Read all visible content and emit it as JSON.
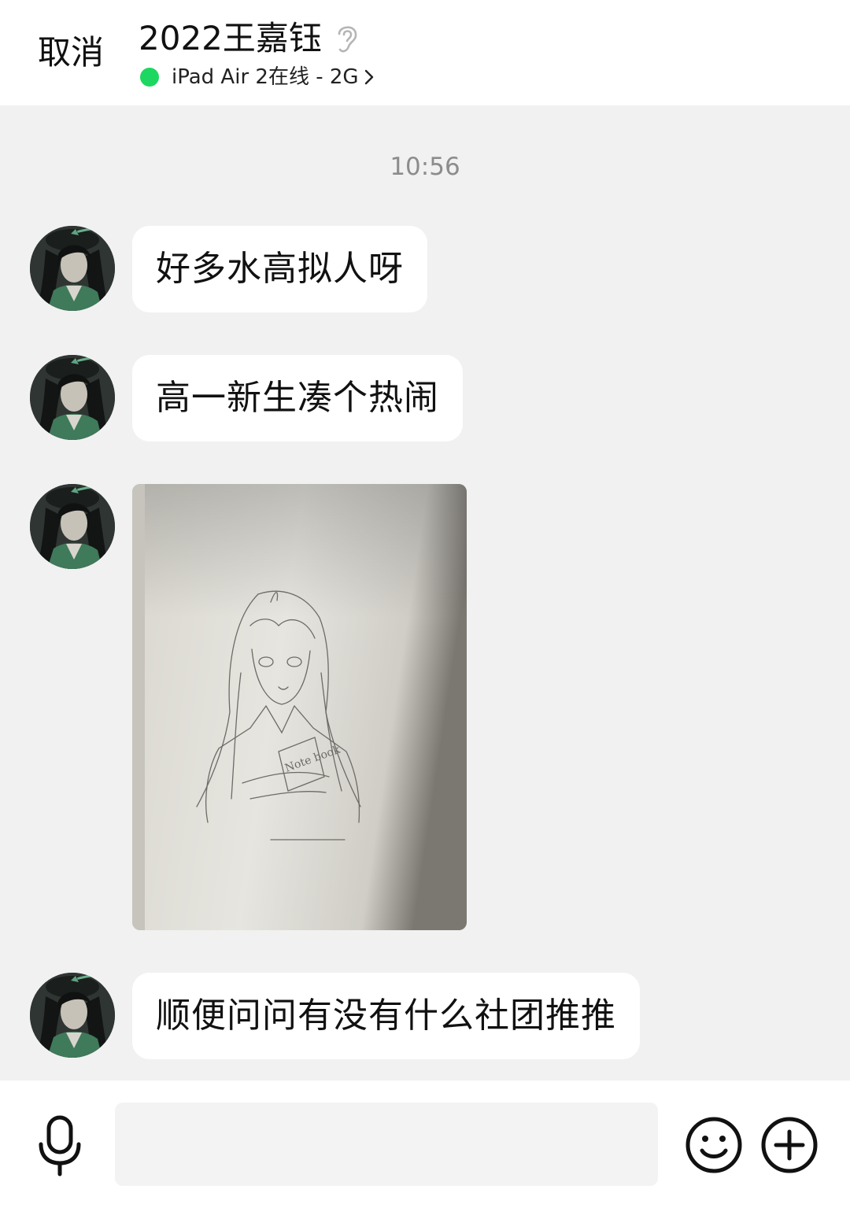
{
  "header": {
    "cancel_label": "取消",
    "title": "2022王嘉钰",
    "status_text": "iPad Air 2在线 - 2G",
    "status_color": "#1ed760"
  },
  "timestamp": "10:56",
  "messages": [
    {
      "type": "text",
      "text": "好多水高拟人呀"
    },
    {
      "type": "text",
      "text": "高一新生凑个热闹"
    },
    {
      "type": "image",
      "caption": "Note book"
    },
    {
      "type": "text",
      "text": "顺便问问有没有什么社团推推"
    }
  ],
  "input": {
    "placeholder": ""
  },
  "icons": {
    "ear": "ear-icon",
    "voice": "microphone-icon",
    "emoji": "smiley-icon",
    "add": "plus-circle-icon"
  },
  "colors": {
    "background": "#f1f1f1",
    "bubble": "#ffffff",
    "online": "#1ed760"
  }
}
